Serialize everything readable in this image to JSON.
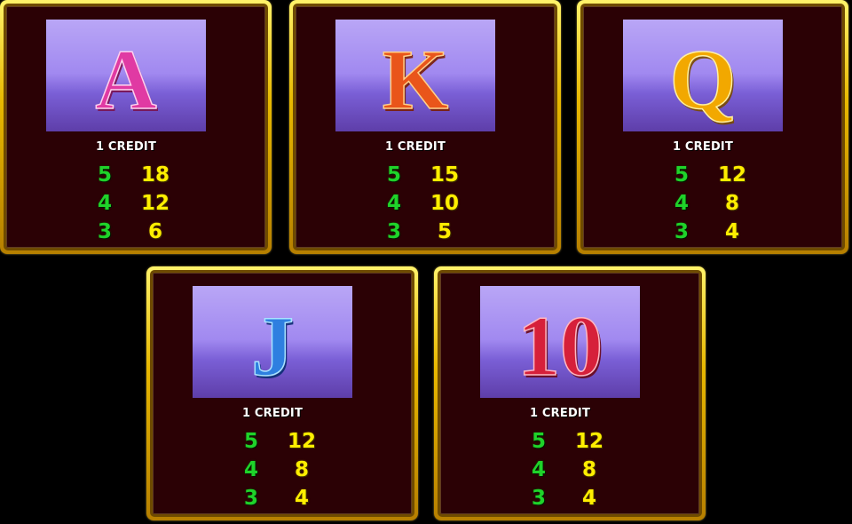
{
  "paytable": {
    "cards": [
      {
        "symbol": "A",
        "symbol_color": "#e03aa3",
        "credit_label": "1 CREDIT",
        "rows": [
          {
            "count": "5",
            "payout": "18"
          },
          {
            "count": "4",
            "payout": "12"
          },
          {
            "count": "3",
            "payout": "6"
          }
        ]
      },
      {
        "symbol": "K",
        "symbol_color": "#e9551a",
        "credit_label": "1 CREDIT",
        "rows": [
          {
            "count": "5",
            "payout": "15"
          },
          {
            "count": "4",
            "payout": "10"
          },
          {
            "count": "3",
            "payout": "5"
          }
        ]
      },
      {
        "symbol": "Q",
        "symbol_color": "#f2a800",
        "credit_label": "1 CREDIT",
        "rows": [
          {
            "count": "5",
            "payout": "12"
          },
          {
            "count": "4",
            "payout": "8"
          },
          {
            "count": "3",
            "payout": "4"
          }
        ]
      },
      {
        "symbol": "J",
        "symbol_color": "#2e7fe0",
        "credit_label": "1 CREDIT",
        "rows": [
          {
            "count": "5",
            "payout": "12"
          },
          {
            "count": "4",
            "payout": "8"
          },
          {
            "count": "3",
            "payout": "4"
          }
        ]
      },
      {
        "symbol": "10",
        "symbol_color": "#d6203a",
        "credit_label": "1 CREDIT",
        "rows": [
          {
            "count": "5",
            "payout": "12"
          },
          {
            "count": "4",
            "payout": "8"
          },
          {
            "count": "3",
            "payout": "4"
          }
        ]
      }
    ]
  }
}
